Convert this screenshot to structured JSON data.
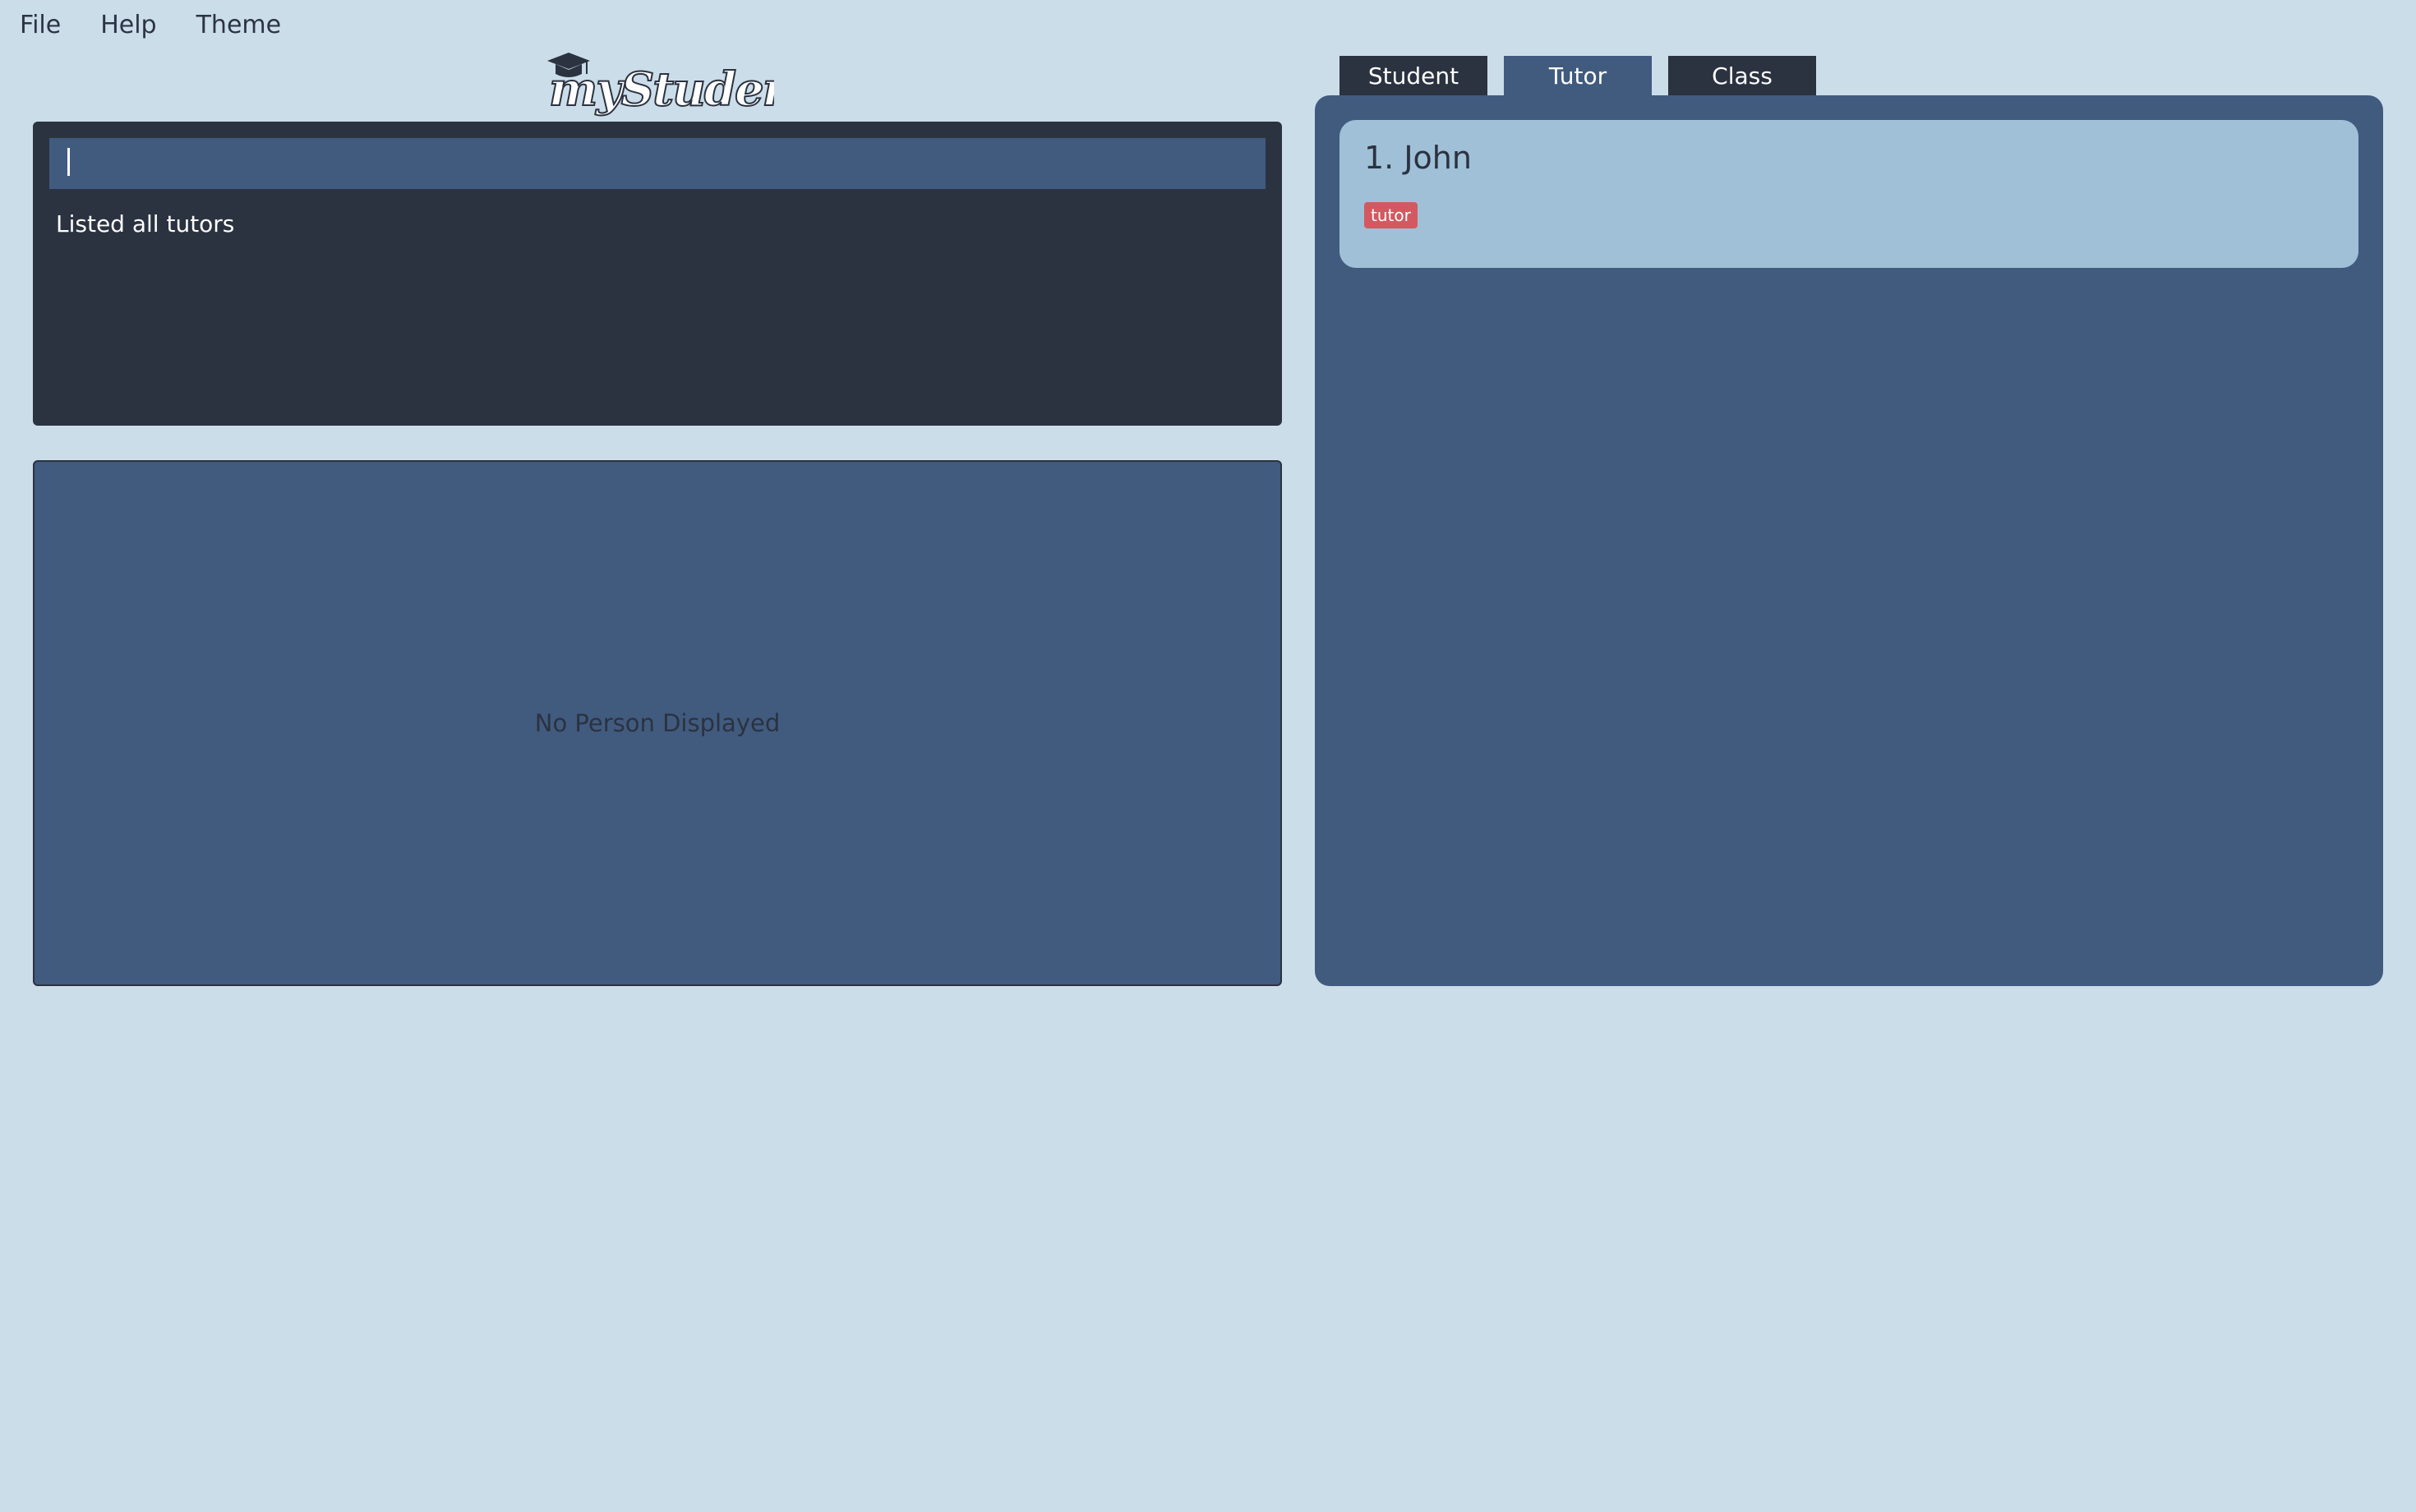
{
  "menu": {
    "items": [
      {
        "label": "File"
      },
      {
        "label": "Help"
      },
      {
        "label": "Theme"
      }
    ]
  },
  "logo": {
    "text": "myStudent",
    "icon": "graduation-cap-icon"
  },
  "command": {
    "value": "",
    "result": "Listed all tutors"
  },
  "detail": {
    "empty_text": "No Person Displayed"
  },
  "tabs": [
    {
      "label": "Student",
      "active": false
    },
    {
      "label": "Tutor",
      "active": true
    },
    {
      "label": "Class",
      "active": false
    }
  ],
  "list": {
    "items": [
      {
        "name": "1. John",
        "tags": [
          "tutor"
        ]
      }
    ]
  },
  "colors": {
    "background": "#cbdde9",
    "dark_panel": "#2b3240",
    "blue_panel": "#415b7f",
    "card": "#9fc0d6",
    "tag": "#d4585f"
  }
}
